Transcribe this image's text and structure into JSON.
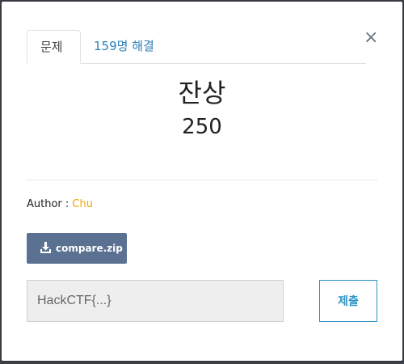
{
  "tabs": [
    {
      "label": "문제"
    },
    {
      "label": "159명 해결"
    }
  ],
  "close_icon": "×",
  "challenge": {
    "title": "잔상",
    "points": "250"
  },
  "author": {
    "prefix": "Author : ",
    "name": "Chu"
  },
  "download": {
    "label": "compare.zip",
    "icon": "download-icon"
  },
  "flag": {
    "placeholder": "HackCTF{...}",
    "value": ""
  },
  "submit": {
    "label": "제출"
  },
  "colors": {
    "accent": "#2c93c8",
    "author_name": "#f0a500",
    "download_button": "#5a7192"
  }
}
